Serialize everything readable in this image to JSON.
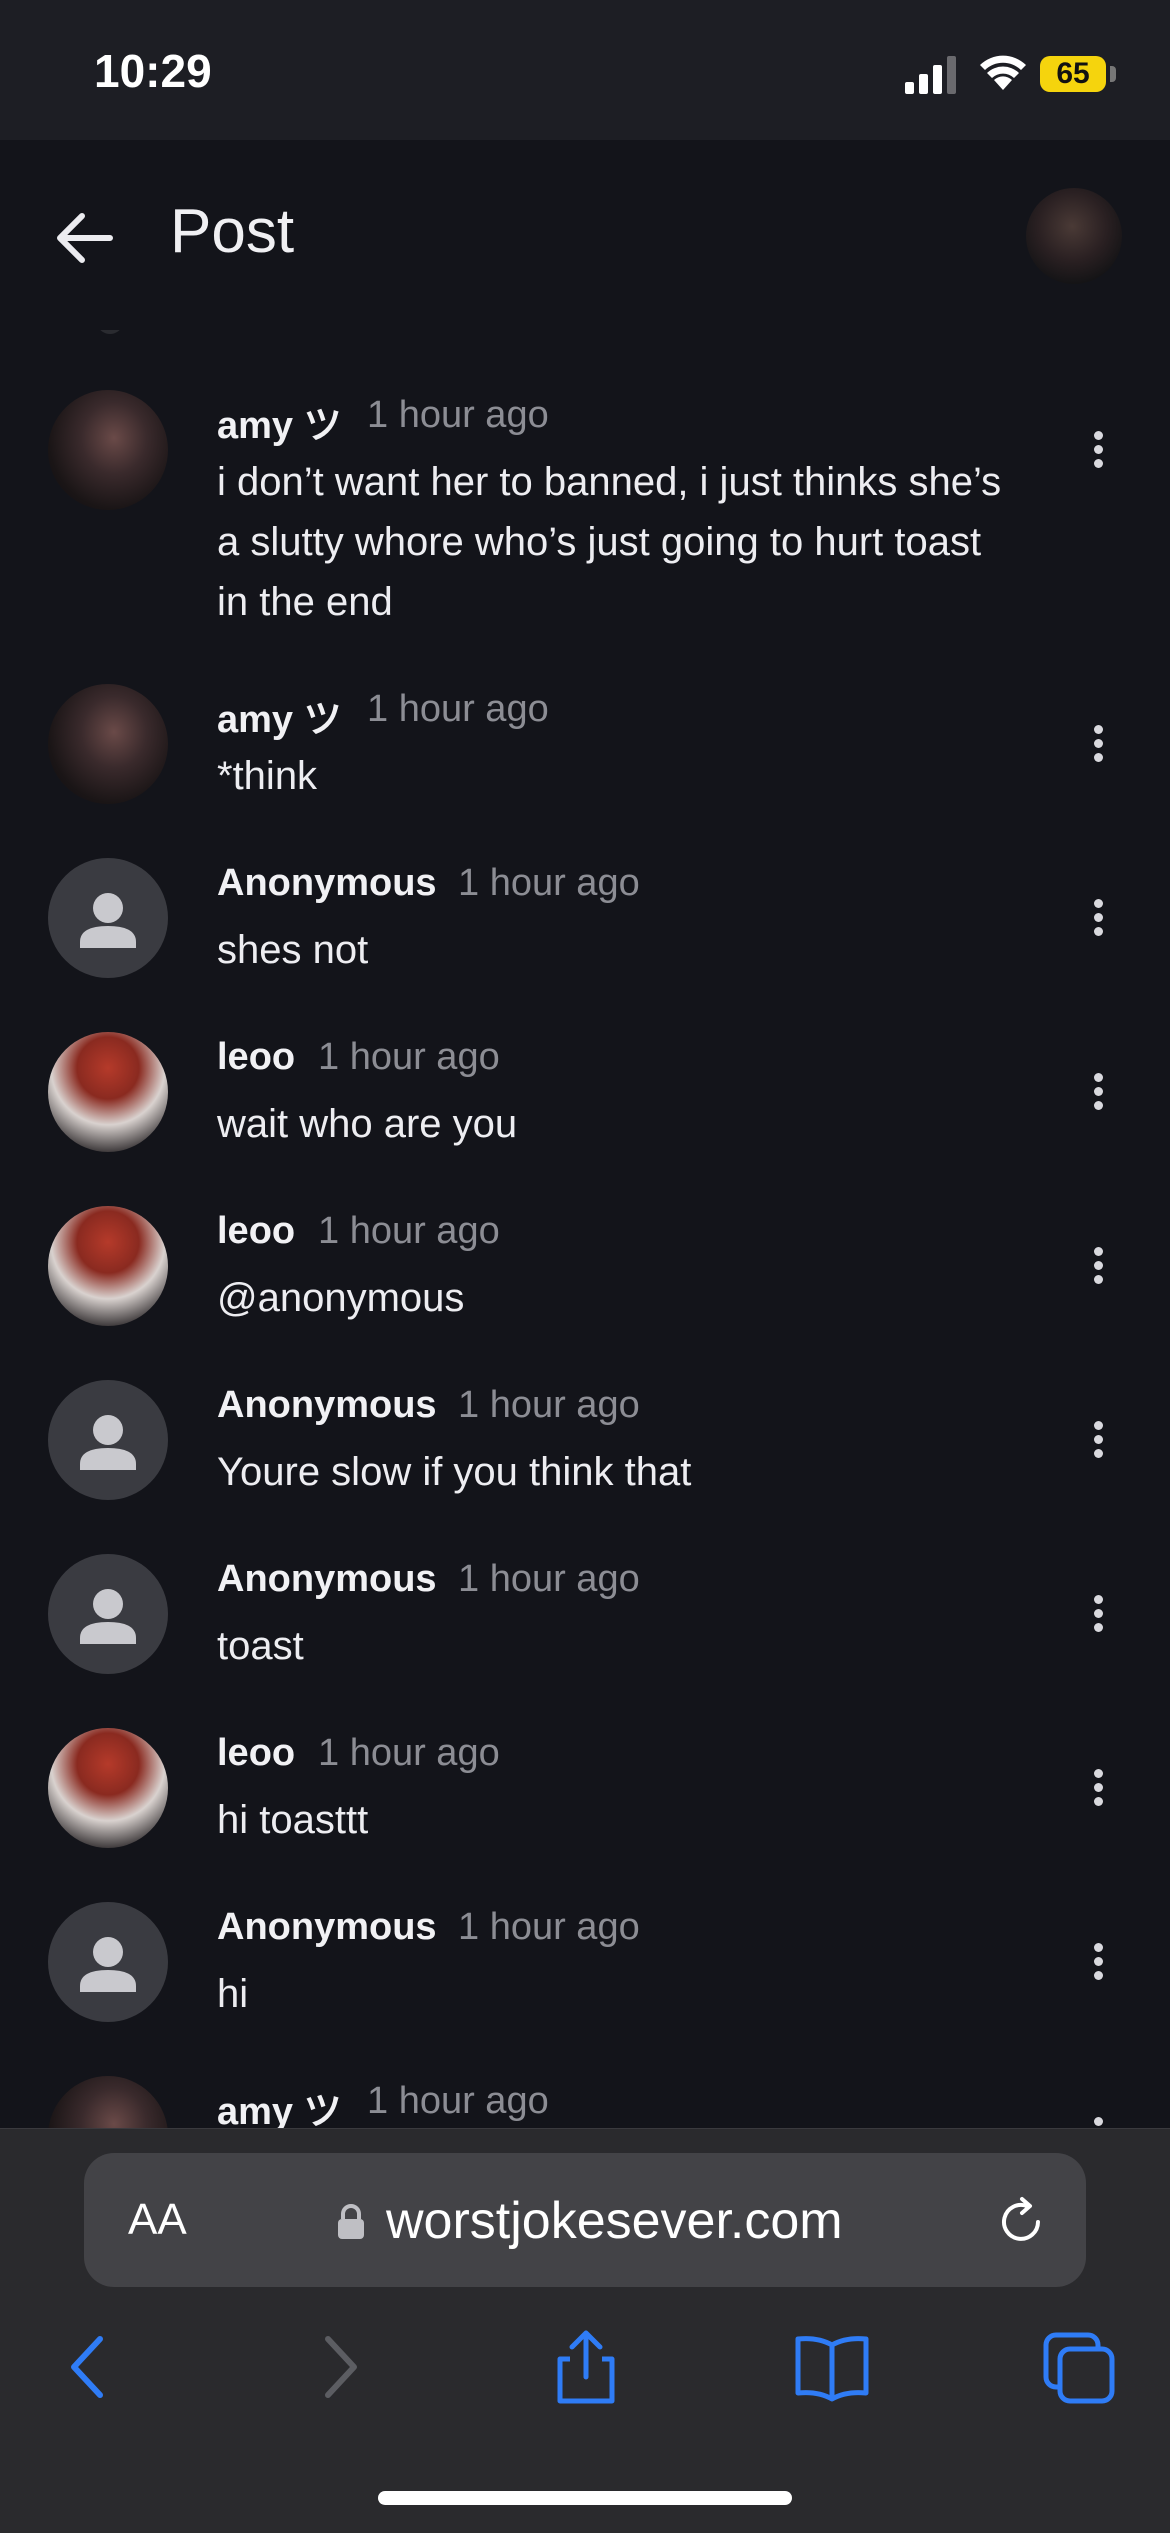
{
  "status_bar": {
    "time": "10:29",
    "battery": "65"
  },
  "header": {
    "title": "Post"
  },
  "comments": [
    {
      "author": "amy ツ",
      "time": "1 hour ago",
      "text": "i don’t want her to banned, i just thinks she’s a slutty whore who’s just going to hurt toast in the end",
      "avatar": "amy-photo"
    },
    {
      "author": "amy ツ",
      "time": "1 hour ago",
      "text": "*think",
      "avatar": "amy-photo"
    },
    {
      "author": "Anonymous",
      "time": "1 hour ago",
      "text": "shes not",
      "avatar": "person-icon"
    },
    {
      "author": "leoo",
      "time": "1 hour ago",
      "text": "wait who are you",
      "avatar": "leoo-photo"
    },
    {
      "author": "leoo",
      "time": "1 hour ago",
      "text": "@anonymous",
      "avatar": "leoo-photo"
    },
    {
      "author": "Anonymous",
      "time": "1 hour ago",
      "text": "Youre slow if you think that",
      "avatar": "person-icon"
    },
    {
      "author": "Anonymous",
      "time": "1 hour ago",
      "text": "toast",
      "avatar": "person-icon"
    },
    {
      "author": "leoo",
      "time": "1 hour ago",
      "text": "hi toasttt",
      "avatar": "leoo-photo"
    },
    {
      "author": "Anonymous",
      "time": "1 hour ago",
      "text": "hi",
      "avatar": "person-icon"
    },
    {
      "author": "amy ツ",
      "time": "1 hour ago",
      "text": "",
      "avatar": "amy-photo"
    }
  ],
  "browser": {
    "text_size_label": "AA",
    "url": "worstjokesever.com",
    "toolbar": [
      "back-icon",
      "forward-icon",
      "share-icon",
      "bookmarks-icon",
      "tabs-icon"
    ]
  },
  "colors": {
    "background": "#13141a",
    "accent": "#2f7cf6",
    "battery": "#f5d40d"
  }
}
